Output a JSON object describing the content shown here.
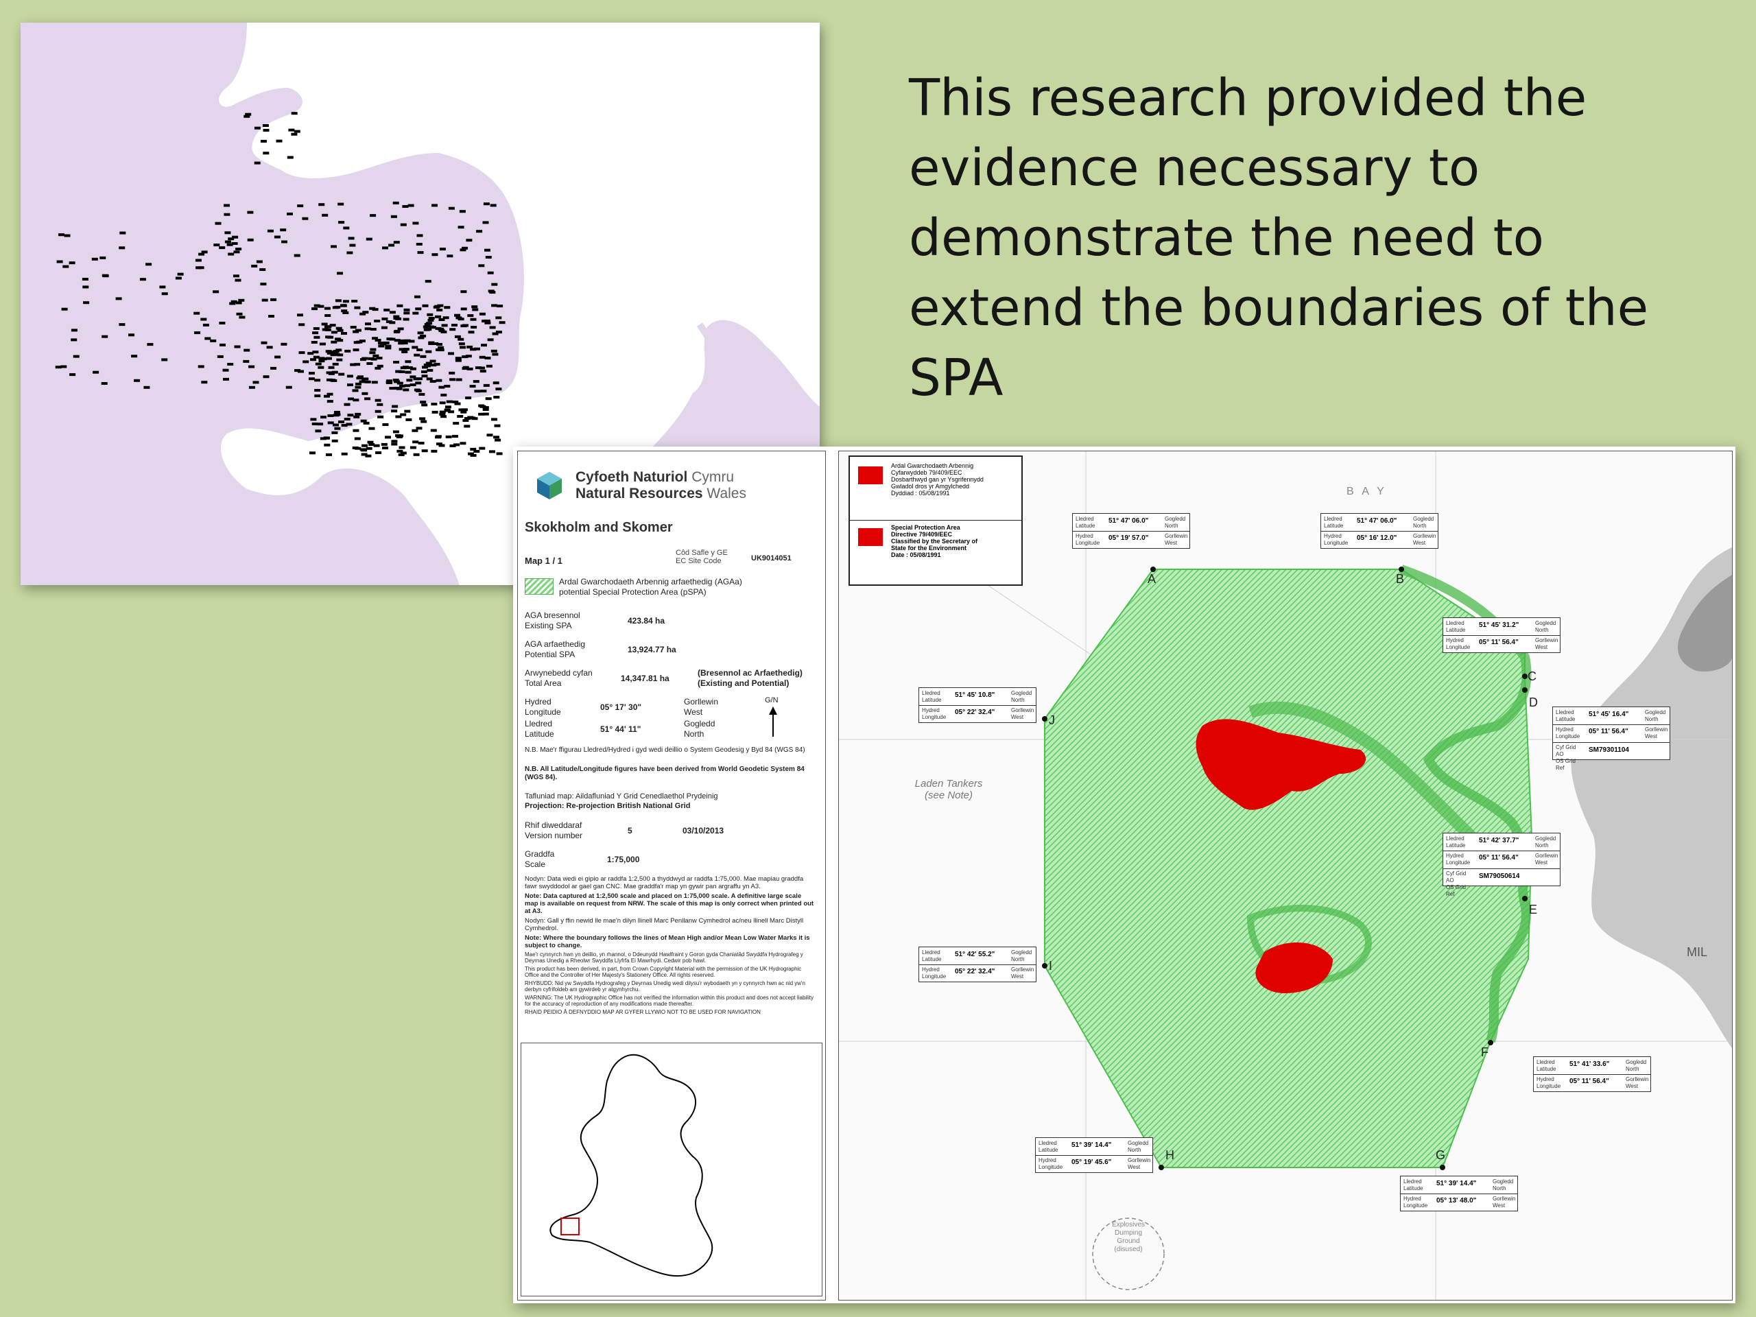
{
  "headline": "This research provided the\nevidence necessary to\ndemonstrate the need to\nextend the boundaries of the\nSPA",
  "doc": {
    "org_name_welsh_bold": "Cyfoeth Naturiol",
    "org_name_welsh_light": "Cymru",
    "org_name_english_bold": "Natural Resources",
    "org_name_english_light": "Wales",
    "site_title": "Skokholm and Skomer",
    "map_no": "Map 1 / 1",
    "site_code_label": "Côd Safle y GE\nEC Site Code",
    "site_code": "UK9014051",
    "pspa_label": "Ardal Gwarchodaeth Arbennig arfaethedig (AGAa)\npotential Special Protection Area (pSPA)",
    "existing_label": "AGA bresennol\nExisting SPA",
    "existing_value": "423.84 ha",
    "potential_label": "AGA arfaethedig\nPotential SPA",
    "potential_value": "13,924.77 ha",
    "total_label": "Arwynebedd cyfan\nTotal Area",
    "total_value": "14,347.81 ha",
    "total_note": "(Bresennol ac Arfaethedig)\n(Existing and Potential)",
    "longitude_label": "Hydred\nLongitude",
    "longitude_value": "05° 17' 30\"",
    "longitude_dir": "Gorllewin\nWest",
    "latitude_label": "Lledred\nLatitude",
    "latitude_value": "51° 44' 11\"",
    "latitude_dir": "Gogledd\nNorth",
    "grid_north": "G/N",
    "wgs_welsh": "N.B. Mae'r ffigurau Lledred/Hydred i gyd wedi deillio o System Geodesig y Byd 84 (WGS 84)",
    "wgs_english": "N.B. All Latitude/Longitude figures have been derived from World Geodetic System 84 (WGS 84).",
    "projection_welsh": "Tafluniad map: Aildafluniad Y Grid Cenedlaethol Prydeinig",
    "projection_english": "Projection: Re-projection British National Grid",
    "version_label": "Rhif diweddaraf\nVersion number",
    "version_value": "5",
    "version_date": "03/10/2013",
    "scale_label": "Graddfa\nScale",
    "scale_value": "1:75,000",
    "note_1": "Nodyn: Data wedi ei gipio ar raddfa 1:2,500 a thyddwyd ar raddfa 1:75,000. Mae mapiau graddfa fawr swyddodol ar gael gan CNC. Mae graddfa'r map yn gywir pan argraffu yn A3.",
    "note_2": "Note: Data captured at 1:2,500 scale and placed on 1:75,000 scale. A definitive large scale map is available on request from NRW. The scale of this map is only correct when printed out at A3.",
    "note_3": "Nodyn: Gall y ffin newid lle mae'n dilyn llinell Marc Penllanw Cymhedrol ac/neu llinell Marc Distyll Cymhedrol.",
    "note_4": "Note: Where the boundary follows the lines of Mean High and/or Mean Low Water Marks it is subject to change.",
    "note_5": "Mae'r cynnyrch hwn yn deillio, yn rhannol, o Ddeunydd Hawlfraint y Goron gyda Chaniatâd Swyddfa Hydrografeg y Deyrnas Unedig a Rheolwr Swyddfa Llyfrfa Ei Mawrhydi. Cedwir pob hawl.",
    "note_6": "This product has been derived, in part, from Crown Copyright Material with the permission of the UK Hydrographic Office and the Controller of Her Majesty's Stationery Office. All rights reserved.",
    "note_7": "RHYBUDD: Nid yw Swyddfa Hydrografeg y Deyrnas Unedig wedi dilysu'r wybodaeth yn y cynnyrch hwn ac nid yw'n derbyn cyfrifoldeb am gywirdeb yr atgynhyrchu.",
    "note_8": "WARNING: The UK Hydrographic Office has not verified the information within this product and does not accept liability for the accuracy of reproduction of any modifications made thereafter.",
    "note_9": "RHAID PEIDIO Â DEFNYDDIO MAP AR GYFER LLYWIO    NOT TO BE USED FOR NAVIGATION"
  },
  "chart": {
    "legend_existing_welsh": "Ardal Gwarchodaeth Arbennig\nCyfarwyddeb 79/409/EEC\nDosbarthwyd gan yr Ysgrifennydd\nGwladol dros yr Amgylchedd\nDyddiad : 05/08/1991",
    "legend_existing_english": "Special Protection Area\nDirective 79/409/EEC\nClassified by the Secretary of\nState for the Environment\nDate : 05/08/1991",
    "laden_tankers": "Laden Tankers\n(see Note)",
    "bay_label": "B A Y",
    "mil_label": "MIL",
    "explosives_label": "Explosives\nDumping\nGround\n(disused)",
    "points": [
      {
        "id": "A",
        "lat": "51° 47' 06.0\"",
        "lon": "05° 19' 57.0\""
      },
      {
        "id": "B",
        "lat": "51° 47' 06.0\"",
        "lon": "05° 16' 12.0\""
      },
      {
        "id": "C",
        "lat": "51° 45' 31.2\"",
        "lon": "05° 11' 56.4\""
      },
      {
        "id": "D",
        "lat": "51° 45' 16.4\"",
        "lon": "05° 11' 56.4\"",
        "grid_ref": "SM79301104"
      },
      {
        "id": "E",
        "lat": "51° 42' 37.7\"",
        "lon": "05° 11' 56.4\"",
        "grid_ref": "SM79050614"
      },
      {
        "id": "F",
        "lat": "51° 41' 33.6\"",
        "lon": "05° 11' 56.4\""
      },
      {
        "id": "G",
        "lat": "51° 39' 14.4\"",
        "lon": "05° 13' 48.0\""
      },
      {
        "id": "H",
        "lat": "51° 39' 14.4\"",
        "lon": "05° 19' 45.6\""
      },
      {
        "id": "I",
        "lat": "51° 42' 55.2\"",
        "lon": "05° 22' 32.4\""
      },
      {
        "id": "J",
        "lat": "51° 45' 10.8\"",
        "lon": "05° 22' 32.4\""
      }
    ],
    "lat_label": "Lledred\nLatitude",
    "lon_label": "Hydred\nLongitude",
    "north_label": "Gogledd\nNorth",
    "west_label": "Gorllewin\nWest",
    "grid_label": "Cyf Grid AO\nOS Grid Ref"
  },
  "colors": {
    "slide_background": "#c5d6a0",
    "sighting_sea": "#e3d5ec",
    "pspa_green": "#6fd36f",
    "existing_spa_red": "#e00000",
    "nrw_logo_blue": "#1f6e9c",
    "nrw_logo_green": "#3a9a5a"
  }
}
